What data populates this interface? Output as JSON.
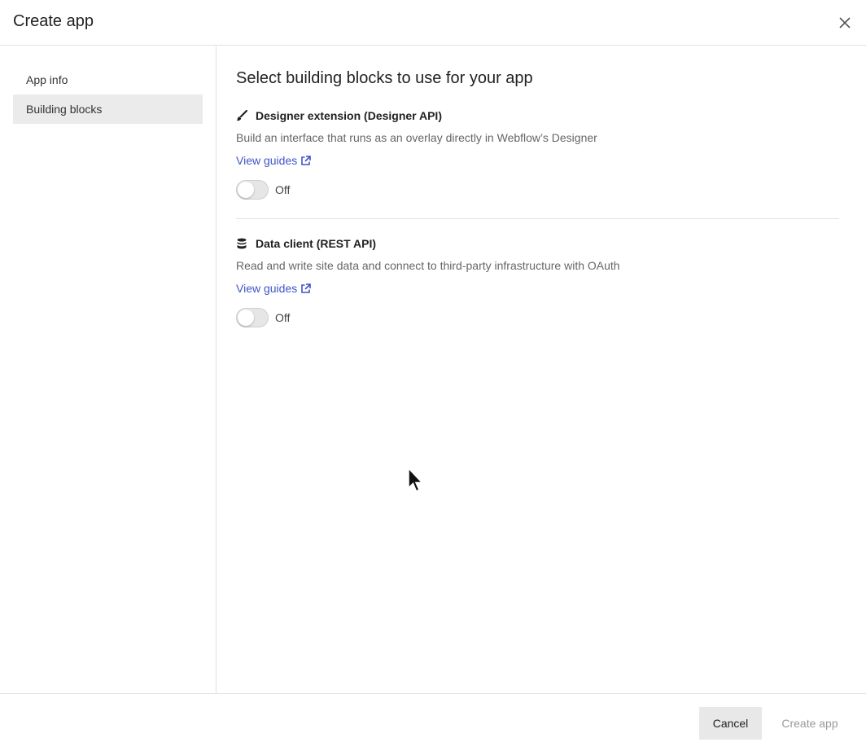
{
  "dialog": {
    "title": "Create app",
    "close_label": "×"
  },
  "sidebar": {
    "items": [
      {
        "label": "App info",
        "active": false
      },
      {
        "label": "Building blocks",
        "active": true
      }
    ]
  },
  "main": {
    "heading": "Select building blocks to use for your app",
    "blocks": [
      {
        "icon": "paintbrush-icon",
        "title": "Designer extension (Designer API)",
        "description": "Build an interface that runs as an overlay directly in Webflow’s Designer",
        "link_label": "View guides",
        "toggle_label": "Off",
        "enabled": false
      },
      {
        "icon": "database-icon",
        "title": "Data client (REST API)",
        "description": "Read and write site data and connect to third-party infrastructure with OAuth",
        "link_label": "View guides",
        "toggle_label": "Off",
        "enabled": false
      }
    ]
  },
  "footer": {
    "cancel_label": "Cancel",
    "create_label": "Create app"
  },
  "colors": {
    "link": "#3d55c8",
    "active_nav": "#ebebeb",
    "border": "#e2e2e2",
    "disabled_text": "#9a9a9a"
  }
}
